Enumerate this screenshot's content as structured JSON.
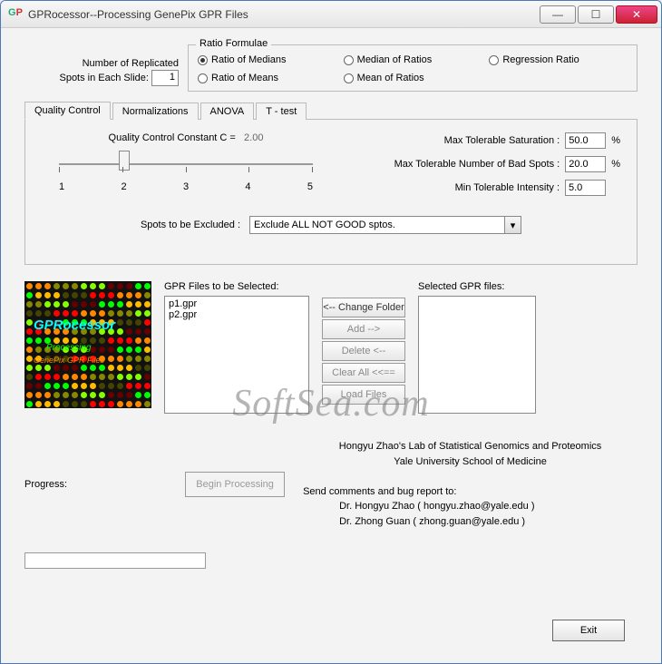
{
  "window": {
    "title": "GPRocessor--Processing GenePix GPR Files"
  },
  "replicated": {
    "label_line1": "Number of Replicated",
    "label_line2": "Spots in Each Slide:",
    "value": "1"
  },
  "ratio": {
    "legend": "Ratio Formulae",
    "options": [
      "Ratio of Medians",
      "Median of Ratios",
      "Regression Ratio",
      "Ratio of Means",
      "Mean of Ratios"
    ],
    "selected_index": 0
  },
  "tabs": {
    "items": [
      "Quality Control",
      "Normalizations",
      "ANOVA",
      "T - test"
    ],
    "active_index": 0
  },
  "qc": {
    "constant_label": "Quality Control Constant   C =",
    "constant_value": "2.00",
    "slider_min_tick": "1",
    "slider_max_tick": "5",
    "tick_labels": [
      "1",
      "2",
      "3",
      "4",
      "5"
    ],
    "fields": {
      "max_saturation_label": "Max Tolerable Saturation :",
      "max_saturation_value": "50.0",
      "max_bad_label": "Max Tolerable Number of Bad Spots :",
      "max_bad_value": "20.0",
      "min_intensity_label": "Min Tolerable Intensity :",
      "min_intensity_value": "5.0",
      "percent": "%"
    },
    "exclude_label": "Spots to be Excluded :",
    "exclude_value": "Exclude ALL NOT GOOD sptos."
  },
  "files": {
    "available_label": "GPR Files to be Selected:",
    "available_items": [
      "p1.gpr",
      "p2.gpr"
    ],
    "selected_label": "Selected GPR files:",
    "buttons": {
      "change": "<-- Change Folder",
      "add": "Add -->",
      "delete": "Delete <--",
      "clearall": "Clear All <<==",
      "load": "Load Files"
    }
  },
  "logo": {
    "line1": "GPRocessor",
    "line2": "Processing",
    "line3": "GenePix GPR Files"
  },
  "bottom": {
    "progress_label": "Progress:",
    "begin_label": "Begin Processing",
    "credit1": "Hongyu Zhao's Lab of Statistical Genomics and Proteomics",
    "credit2": "Yale University School of Medicine",
    "credit3": "Send comments and bug report to:",
    "credit4": "Dr. Hongyu Zhao  ( hongyu.zhao@yale.edu )",
    "credit5": "Dr. Zhong Guan  ( zhong.guan@yale.edu )"
  },
  "exit_label": "Exit",
  "watermark": "SoftSea.com"
}
